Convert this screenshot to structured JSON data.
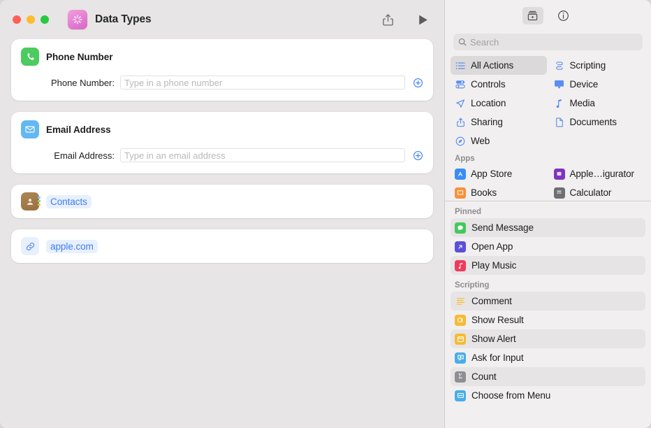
{
  "window": {
    "title": "Data Types",
    "app_icon": "shortcuts-icon",
    "traffic_lights": [
      "close",
      "minimize",
      "zoom"
    ]
  },
  "toolbar": {
    "share_label": "share-icon",
    "run_label": "run-icon"
  },
  "editor": {
    "actions": [
      {
        "type": "action",
        "icon": "phone-icon",
        "icon_color": "#4ccb5f",
        "title": "Phone Number",
        "field_label": "Phone Number:",
        "field_value": "",
        "field_placeholder": "Type in a phone number",
        "add_button": "add-variable-icon"
      },
      {
        "type": "action",
        "icon": "mail-icon",
        "icon_color": "#63b8f2",
        "title": "Email Address",
        "field_label": "Email Address:",
        "field_value": "",
        "field_placeholder": "Type in an email address",
        "add_button": "add-variable-icon"
      },
      {
        "type": "token",
        "icon": "contacts-app-icon",
        "token": "Contacts"
      },
      {
        "type": "token",
        "icon": "link-icon",
        "token": "apple.com"
      }
    ]
  },
  "sidebar": {
    "toolbar": {
      "library_tab": "action-library-icon",
      "info_tab": "info-circle-icon"
    },
    "search": {
      "placeholder": "Search",
      "value": "",
      "icon": "search-icon"
    },
    "categories": [
      {
        "label": "All Actions",
        "icon": "list-bullet-icon",
        "selected": true
      },
      {
        "label": "Scripting",
        "icon": "scroll-icon",
        "selected": false
      },
      {
        "label": "Controls",
        "icon": "controls-icon",
        "selected": false
      },
      {
        "label": "Device",
        "icon": "display-icon",
        "selected": false
      },
      {
        "label": "Location",
        "icon": "paperplane-icon",
        "selected": false
      },
      {
        "label": "Media",
        "icon": "music-note-icon",
        "selected": false
      },
      {
        "label": "Sharing",
        "icon": "share-icon",
        "selected": false
      },
      {
        "label": "Documents",
        "icon": "document-icon",
        "selected": false
      },
      {
        "label": "Web",
        "icon": "safari-icon",
        "selected": false
      }
    ],
    "apps_header": "Apps",
    "apps": [
      {
        "label": "App Store",
        "icon": "app-store-icon",
        "color": "#3a8df5"
      },
      {
        "label": "Apple…igurator",
        "icon": "apple-configurator-icon",
        "color": "#7d35c0"
      },
      {
        "label": "Books",
        "icon": "books-icon",
        "color": "#f7913a"
      },
      {
        "label": "Calculator",
        "icon": "calculator-icon",
        "color": "#6e6e73"
      }
    ],
    "sections": [
      {
        "header": "Pinned",
        "items": [
          {
            "label": "Send Message",
            "icon": "messages-icon",
            "color": "#45c85a",
            "glyph": "●"
          },
          {
            "label": "Open App",
            "icon": "open-app-icon",
            "color": "#5a50d8",
            "glyph": "↗"
          },
          {
            "label": "Play Music",
            "icon": "music-icon",
            "color": "#ef3b5b",
            "glyph": "♫"
          }
        ]
      },
      {
        "header": "Scripting",
        "items": [
          {
            "label": "Comment",
            "icon": "comment-icon",
            "color": "#f5c13c",
            "glyph": "≡"
          },
          {
            "label": "Show Result",
            "icon": "show-result-icon",
            "color": "#f5bb34",
            "glyph": "⧉"
          },
          {
            "label": "Show Alert",
            "icon": "show-alert-icon",
            "color": "#f5bb34",
            "glyph": "▣"
          },
          {
            "label": "Ask for Input",
            "icon": "ask-input-icon",
            "color": "#4aade8",
            "glyph": "+"
          },
          {
            "label": "Count",
            "icon": "count-icon",
            "color": "#8e8e93",
            "glyph": "Σ"
          },
          {
            "label": "Choose from Menu",
            "icon": "menu-icon",
            "color": "#4aade8",
            "glyph": "▭"
          }
        ]
      }
    ]
  },
  "colors": {
    "accent": "#3b7ff2",
    "token_bg": "#e8f0fe",
    "canvas": "#e7e5e5",
    "sidebar": "#f1efef"
  }
}
